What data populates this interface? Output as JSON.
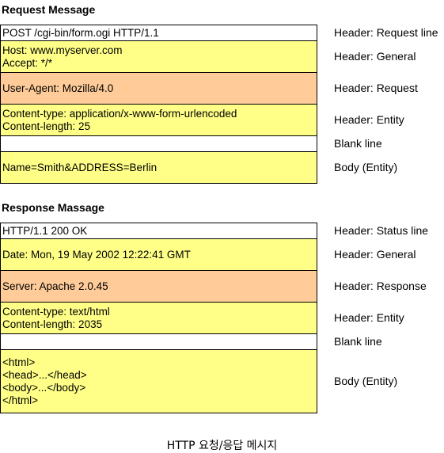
{
  "request": {
    "title": "Request Message",
    "rows": [
      {
        "lines": [
          "POST /cgi-bin/form.ogi HTTP/1.1"
        ],
        "label": "Header: Request line",
        "color": "#ffffff"
      },
      {
        "lines": [
          "Host: www.myserver.com",
          "Accept: */*"
        ],
        "label": "Header: General",
        "color": "#ffff88"
      },
      {
        "lines": [
          "User-Agent: Mozilla/4.0"
        ],
        "label": "Header: Request",
        "color": "#ffcc99"
      },
      {
        "lines": [
          "Content-type: application/x-www-form-urlencoded",
          "Content-length: 25"
        ],
        "label": "Header: Entity",
        "color": "#ffff88"
      },
      {
        "lines": [
          ""
        ],
        "label": "Blank line",
        "color": "#ffffff"
      },
      {
        "lines": [
          "Name=Smith&ADDRESS=Berlin"
        ],
        "label": "Body (Entity)",
        "color": "#ffff88"
      }
    ]
  },
  "response": {
    "title": "Response Massage",
    "rows": [
      {
        "lines": [
          "HTTP/1.1 200 OK"
        ],
        "label": "Header: Status line",
        "color": "#ffffff"
      },
      {
        "lines": [
          "Date: Mon, 19 May 2002 12:22:41 GMT"
        ],
        "label": "Header: General",
        "color": "#ffff88"
      },
      {
        "lines": [
          "Server: Apache 2.0.45"
        ],
        "label": "Header: Response",
        "color": "#ffcc99"
      },
      {
        "lines": [
          "Content-type: text/html",
          "Content-length: 2035"
        ],
        "label": "Header: Entity",
        "color": "#ffff88"
      },
      {
        "lines": [
          ""
        ],
        "label": "Blank line",
        "color": "#ffffff"
      },
      {
        "lines": [
          "<html>",
          "<head>...</head>",
          "<body>...</body>",
          "</html>"
        ],
        "label": "Body (Entity)",
        "color": "#ffff88"
      }
    ]
  },
  "caption": "HTTP 요청/응답 메시지"
}
